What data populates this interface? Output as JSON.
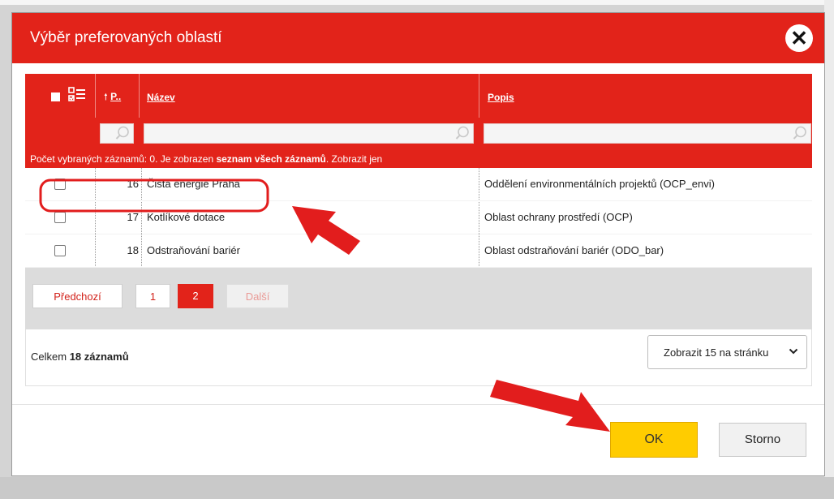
{
  "dialog": {
    "title": "Výběr preferovaných oblastí",
    "close_symbol": "✕"
  },
  "table": {
    "columns": {
      "p_arrow": "🠕",
      "p_label": "P..",
      "nazev": "Název",
      "popis": "Popis"
    },
    "info": {
      "prefix": "Počet vybraných záznamů: 0. Je zobrazen ",
      "bold": "seznam všech záznamů",
      "suffix": ". Zobrazit jen"
    },
    "rows": [
      {
        "num": "16",
        "nazev": "Čistá energie Praha",
        "popis": "Oddělení environmentálních projektů (OCP_envi)",
        "checked": false
      },
      {
        "num": "17",
        "nazev": "Kotlíkové dotace",
        "popis": "Oblast ochrany prostředí (OCP)",
        "checked": false
      },
      {
        "num": "18",
        "nazev": "Odstraňování bariér",
        "popis": "Oblast odstraňování bariér (ODO_bar)",
        "checked": false
      }
    ]
  },
  "pager": {
    "prev": "Předchozí",
    "pages": [
      "1",
      "2"
    ],
    "current_page": "2",
    "next": "Další"
  },
  "footer": {
    "total_prefix": "Celkem ",
    "total_bold": "18 záznamů",
    "per_page_value": "Zobrazit 15 na stránku"
  },
  "buttons": {
    "ok": "OK",
    "storno": "Storno"
  },
  "colors": {
    "accent_red": "#e2231a",
    "ok_yellow": "#ffcc00",
    "annotation_red": "#e21d1d"
  },
  "icons": {
    "close": "close-icon",
    "select_all": "checkbox-list-icon",
    "search": "search-icon",
    "dropdown": "chevron-down-icon"
  }
}
